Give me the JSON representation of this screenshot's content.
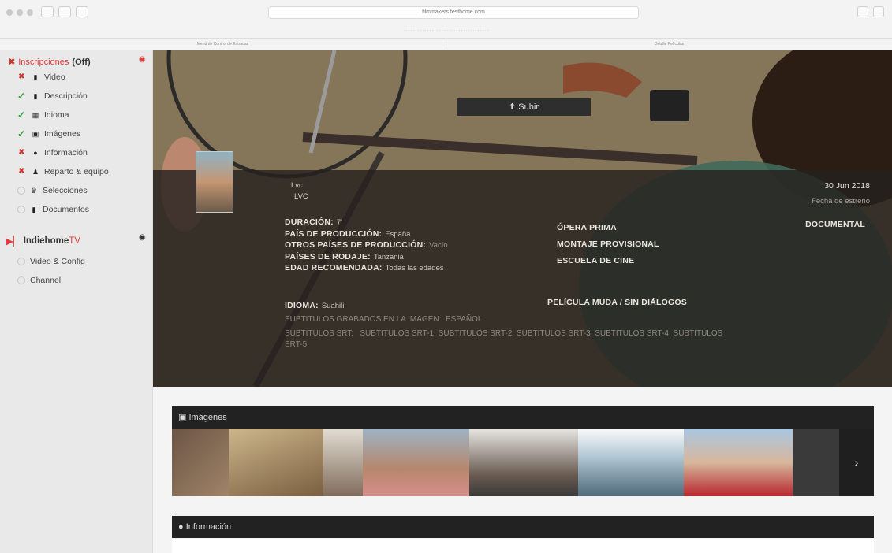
{
  "browser": {
    "url": "filmmakers.festhome.com",
    "tabs": [
      "Menú de Control de Entradas",
      "Detalle Películas"
    ]
  },
  "sidebar": {
    "inscriptions": {
      "label": "Inscripciones",
      "status": "(Off)"
    },
    "items": [
      {
        "label": "Video",
        "status": "bad",
        "icon": "file-icon"
      },
      {
        "label": "Descripción",
        "status": "ok",
        "icon": "file-icon"
      },
      {
        "label": "Idioma",
        "status": "ok",
        "icon": "language-icon"
      },
      {
        "label": "Imágenes",
        "status": "ok",
        "icon": "image-icon"
      },
      {
        "label": "Información",
        "status": "bad",
        "icon": "info-icon"
      },
      {
        "label": "Reparto & equipo",
        "status": "bad",
        "icon": "users-icon"
      },
      {
        "label": "Selecciones",
        "status": "empty",
        "icon": "trophy-icon"
      },
      {
        "label": "Documentos",
        "status": "empty",
        "icon": "file-icon"
      }
    ],
    "indiehome": {
      "label_main": "Indiehome",
      "label_tv": "TV"
    },
    "indie_items": [
      {
        "label": "Video & Config"
      },
      {
        "label": "Channel"
      }
    ]
  },
  "hero": {
    "upload_label": "Subir",
    "title": "Lvc",
    "subtitle": "LVC",
    "date": "30 Jun 2018",
    "date_label": "Fecha de estreno",
    "left_fields": [
      {
        "label": "DURACIÓN:",
        "value": "7'"
      },
      {
        "label": "PAÍS DE PRODUCCIÓN:",
        "value": "España"
      },
      {
        "label": "OTROS PAÍSES DE PRODUCCIÓN:",
        "value": "Vacío"
      },
      {
        "label": "PAÍSES DE RODAJE:",
        "value": "Tanzania"
      },
      {
        "label": "EDAD RECOMENDADA:",
        "value": "Todas las edades"
      }
    ],
    "mid_flags": [
      "ÓPERA PRIMA",
      "MONTAJE PROVISIONAL",
      "ESCUELA DE CINE"
    ],
    "genre": "DOCUMENTAL",
    "idioma_label": "IDIOMA:",
    "idioma_value": "Suahili",
    "mute_label": "PELÍCULA MUDA / SIN DIÁLOGOS",
    "subs_burned": "SUBTITULOS GRABADOS EN LA IMAGEN:",
    "subs_burned_value": "ESPAÑOL",
    "subs_srt_line1": "SUBTITULOS SRT:   SUBTITULOS SRT-1  SUBTITULOS SRT-2  SUBTITULOS SRT-3  SUBTITULOS SRT-4  SUBTITULOS",
    "subs_srt_line2": "SRT-5"
  },
  "panels": {
    "images_title": "Imágenes",
    "info_title": "Información",
    "next_label": "›"
  },
  "colors": {
    "panel_dark": "#222222",
    "accent_red": "#e23c3c",
    "ok_green": "#2f9e3e"
  }
}
